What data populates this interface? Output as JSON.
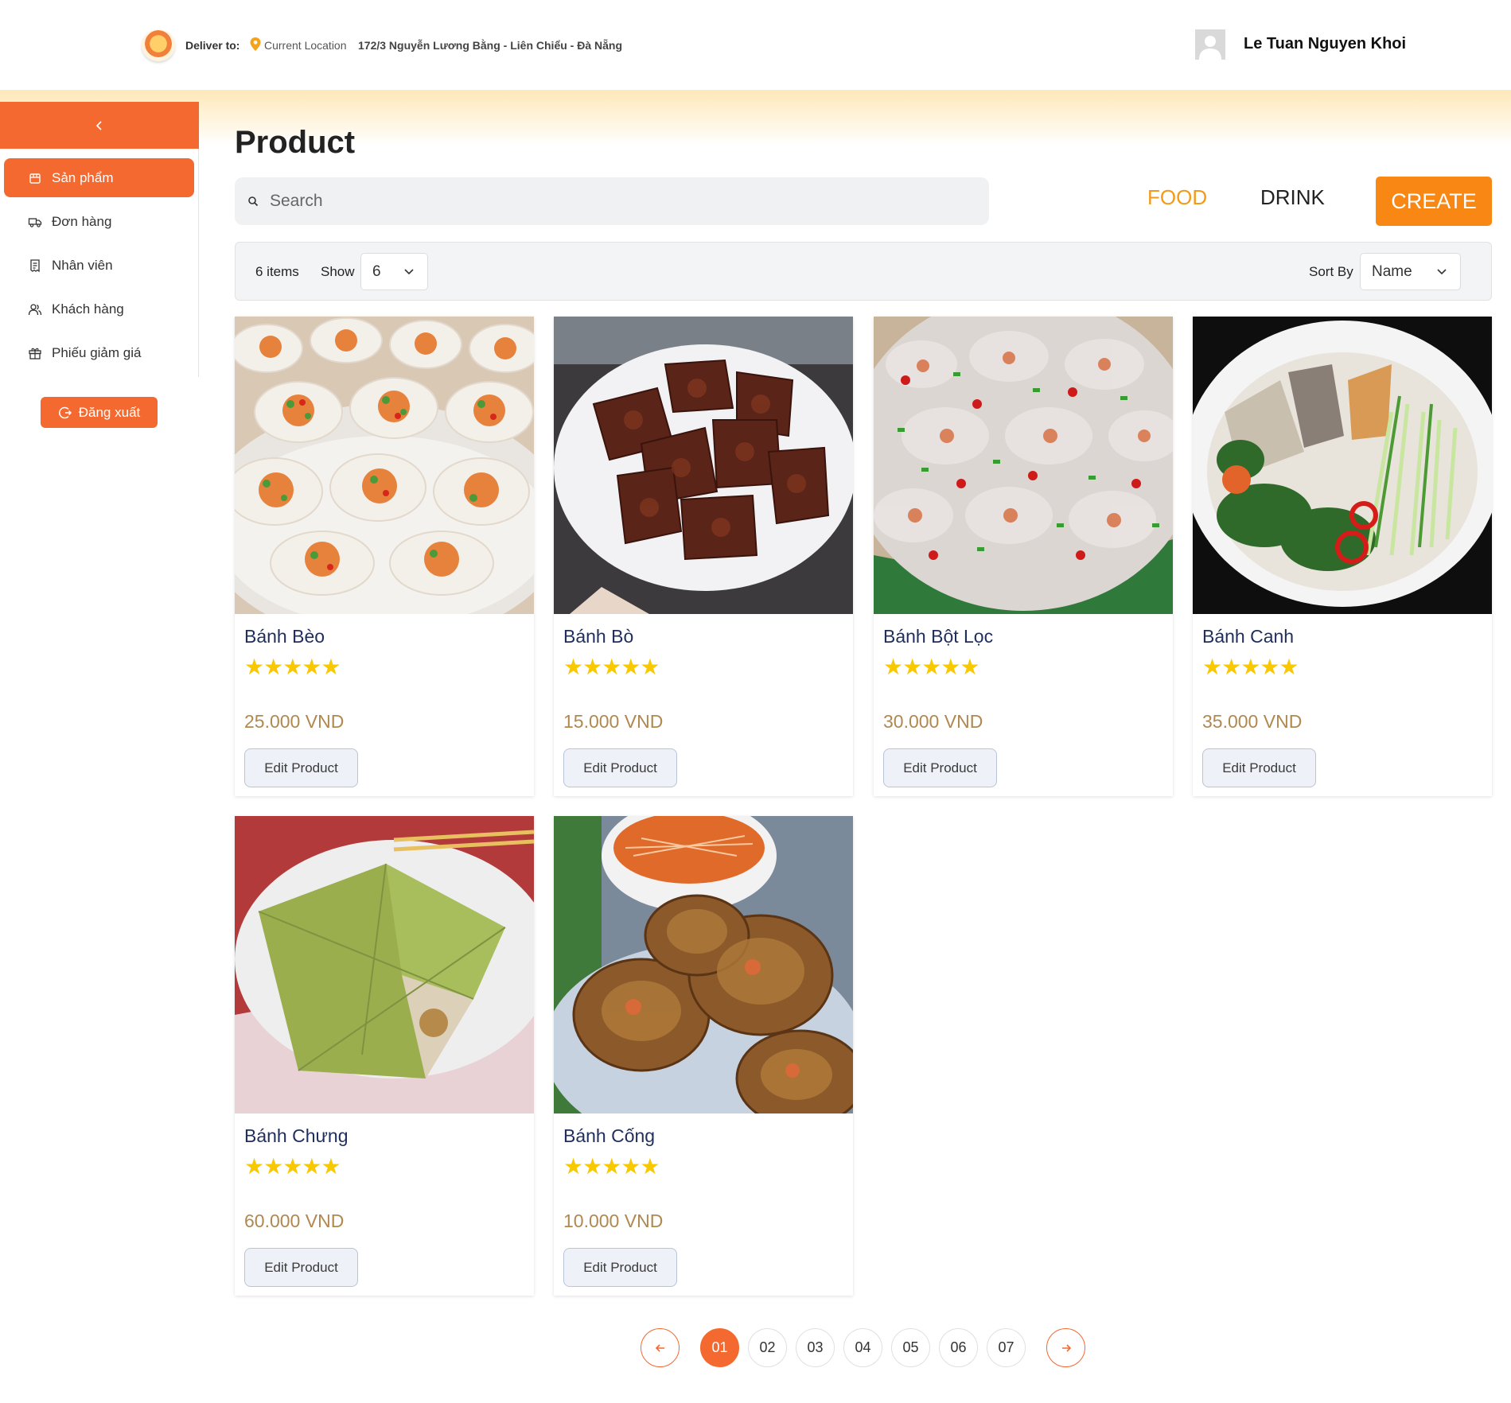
{
  "header": {
    "deliver_label": "Deliver to:",
    "location_label": "Current Location",
    "address": "172/3 Nguyễn Lương Bằng - Liên Chiểu - Đà Nẵng",
    "user_name": "Le Tuan Nguyen Khoi"
  },
  "sidebar": {
    "items": [
      {
        "label": "Sản phẩm",
        "icon": "box-icon",
        "active": true
      },
      {
        "label": "Đơn hàng",
        "icon": "truck-icon",
        "active": false
      },
      {
        "label": "Nhân viên",
        "icon": "receipt-icon",
        "active": false
      },
      {
        "label": "Khách hàng",
        "icon": "users-icon",
        "active": false
      },
      {
        "label": "Phiếu giảm giá",
        "icon": "gift-icon",
        "active": false
      }
    ],
    "logout_label": "Đăng xuất"
  },
  "main": {
    "title": "Product",
    "search_placeholder": "Search",
    "tabs": [
      {
        "label": "FOOD",
        "active": true
      },
      {
        "label": "DRINK",
        "active": false
      }
    ],
    "create_label": "CREATE",
    "item_count": "6 items",
    "show_label": "Show",
    "show_value": "6",
    "sort_label": "Sort By",
    "sort_value": "Name"
  },
  "products": [
    {
      "name": "Bánh Bèo",
      "stars": "★★★★★",
      "price": "25.000 VND",
      "edit_label": "Edit Product"
    },
    {
      "name": "Bánh Bò",
      "stars": "★★★★★",
      "price": "15.000 VND",
      "edit_label": "Edit Product"
    },
    {
      "name": "Bánh Bột Lọc",
      "stars": "★★★★★",
      "price": "30.000 VND",
      "edit_label": "Edit Product"
    },
    {
      "name": "Bánh Canh",
      "stars": "★★★★★",
      "price": "35.000 VND",
      "edit_label": "Edit Product"
    },
    {
      "name": "Bánh Chưng",
      "stars": "★★★★★",
      "price": "60.000 VND",
      "edit_label": "Edit Product"
    },
    {
      "name": "Bánh Cống",
      "stars": "★★★★★",
      "price": "10.000 VND",
      "edit_label": "Edit Product"
    }
  ],
  "pagination": {
    "pages": [
      "01",
      "02",
      "03",
      "04",
      "05",
      "06",
      "07"
    ],
    "current": "01"
  },
  "colors": {
    "accent": "#f4692f",
    "create": "#f98714",
    "food_tab": "#f39a1a",
    "star": "#f8c800",
    "price": "#b08850",
    "product_name": "#1f2e5c"
  }
}
